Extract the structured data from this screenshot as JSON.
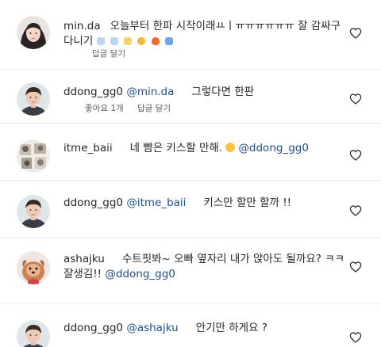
{
  "comments": [
    {
      "username": "min.da",
      "line1": "오늘부터 한파 시작이래ㅛㅣㅠㅠㅠㅠㅠㅠ 잘 감싸구",
      "line2": "다니기",
      "meta": {
        "reply": "답글 달기"
      }
    },
    {
      "username": "ddong_gg0",
      "mention": "@min.da",
      "text": "그렇다면 한판",
      "meta": {
        "likes": "좋아요 1개",
        "reply": "답글 달기"
      }
    },
    {
      "username": "itme_baii",
      "text": "네 빰은 키스할 만해.",
      "mention": "@ddong_gg0"
    },
    {
      "username": "ddong_gg0",
      "mention": "@itme_baii",
      "text": "키스만 할만 할까 !!"
    },
    {
      "username": "ashajku",
      "line1": "수트핏봐~ 오빠 옆자리 내가 앉아도 될까요? ㅋㅋ",
      "line2": "잘생김!!",
      "mention": "@ddong_gg0"
    },
    {
      "username": "ddong_gg0",
      "mention": "@ashajku",
      "text": "안기만 하게요 ?"
    }
  ],
  "icons": {
    "like": "heart-outline-icon",
    "avatar": "avatar-photo"
  },
  "colors": {
    "mention": "#1f4e8a",
    "text": "#262626",
    "meta": "#5c5c5c",
    "divider": "#ececec"
  }
}
